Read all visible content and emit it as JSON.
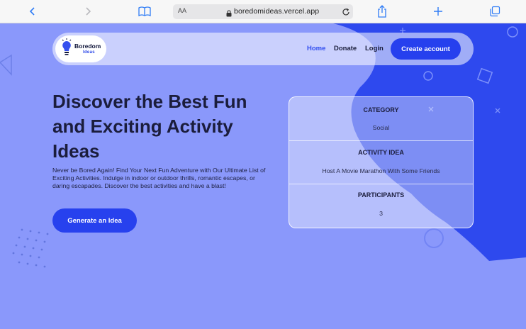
{
  "browser": {
    "text_size_label": "AA",
    "url": "boredomideas.vercel.app"
  },
  "navbar": {
    "logo_title": "Boredom",
    "logo_subtitle": "Ideas",
    "links": [
      "Home",
      "Donate",
      "Login"
    ],
    "active_link": "Home",
    "cta": "Create account"
  },
  "hero": {
    "title_lines": [
      "Discover the Best Fun",
      "and Exciting Activity",
      "Ideas"
    ],
    "description": "Never be Bored Again! Find Your Next Fun Adventure with Our Ultimate List of Exciting Activities. Indulge in indoor or outdoor thrills, romantic escapes, or daring escapades. Discover the best activities and have a blast!",
    "button": "Generate an Idea"
  },
  "card": {
    "sections": [
      {
        "label": "CATEGORY",
        "value": "Social"
      },
      {
        "label": "ACTIVITY IDEA",
        "value": "Host A Movie Marathon With Some Friends"
      },
      {
        "label": "PARTICIPANTS",
        "value": "3"
      }
    ]
  },
  "colors": {
    "background": "#8a98fb",
    "accent": "#2640ee",
    "blob": "#2e49ee"
  },
  "icons": [
    "back-icon",
    "forward-icon",
    "bookmarks-icon",
    "lock-icon",
    "reload-icon",
    "share-icon",
    "new-tab-icon",
    "tabs-icon",
    "lightbulb-logo-icon"
  ]
}
